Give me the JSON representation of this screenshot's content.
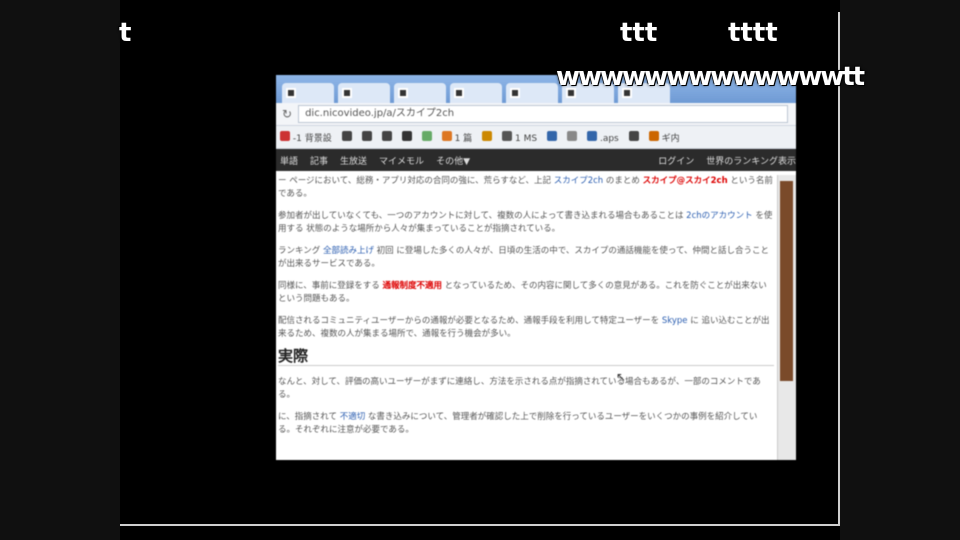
{
  "comments": [
    "t",
    "ttt",
    "tttt",
    "wwwwwwwwwwwwwtt"
  ],
  "browser": {
    "tabs": [
      "",
      "",
      "",
      "",
      "",
      "",
      ""
    ],
    "address": {
      "url": "dic.nicovideo.jp/a/スカイプ2ch"
    },
    "bookmarks": [
      "-1 背景設",
      "",
      "",
      "",
      "",
      "",
      "1 篇",
      "",
      "1 MS",
      "",
      "",
      ".aps",
      "",
      "ギ内"
    ],
    "sitebar": {
      "items": [
        "単語",
        "記事",
        "生放送",
        "マイメモル",
        "その他▼"
      ],
      "right_items": [
        "ログイン",
        "世界のランキング表示"
      ]
    },
    "article": {
      "paragraphs": [
        {
          "pre": "ー ページにおいて、総務・アプリ対応の合同の強に、荒らすなど、上記 ",
          "link": "スカイプ2ch",
          "mid": " のまとめ ",
          "red": "スカイプ@スカイ2ch",
          "post": " という名前である。"
        },
        {
          "pre": "参加者が出していなくても、一つのアカウントに対して、複数の人によって書き込まれる場合もあることは ",
          "link": "2chのアカウント",
          "mid": " を使用する ",
          "red": "",
          "post": "状態のような場所から人々が集まっていることが指摘されている。"
        },
        {
          "pre": "ランキング ",
          "link": "全部読み上げ",
          "mid": " 初回 ",
          "red": "",
          "post": "に登場した多くの人々が、日頃の生活の中で、スカイプの通話機能を使って、仲間と話し合うことが出来るサービスである。"
        },
        {
          "pre": "同様に、事前に登録をする ",
          "link": "",
          "mid": "",
          "red": "通報制度不適用",
          "post": " となっているため、その内容に関して多くの意見がある。これを防ぐことが出来ないという問題もある。"
        },
        {
          "pre": "配信されるコミュニティユーザーからの通報が必要となるため、通報手段を利用して特定ユーザーを ",
          "link": "Skype",
          "mid": " に ",
          "red": "",
          "post": "追い込むことが出来るため、複数の人が集まる場所で、通報を行う機会が多い。"
        }
      ],
      "section_title": "実際",
      "section_paragraphs": [
        {
          "pre": "なんと、対して、評価の高いユーザーがまずに連絡し、方法を示される点が指摘されている場合もあるが、一部のコメントである。",
          "link": "",
          "post": ""
        },
        {
          "pre": "に、指摘されて ",
          "link": "不適切",
          "post": " な書き込みについて、管理者が確認した上で削除を行っているユーザーをいくつかの事例を紹介している。それぞれに注意が必要である。"
        }
      ]
    }
  }
}
